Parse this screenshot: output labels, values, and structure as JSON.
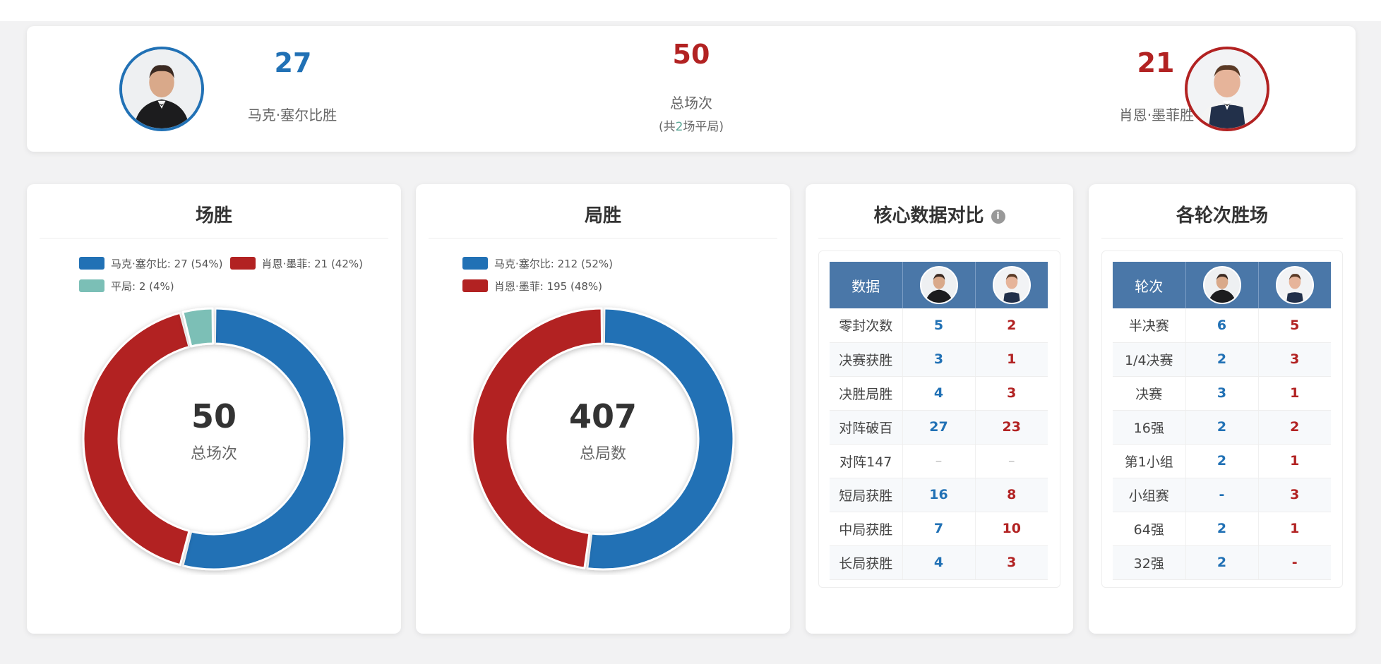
{
  "header": {
    "left": {
      "wins": "27",
      "label": "马克·塞尔比胜",
      "avatar_icon": "player-avatar-selby"
    },
    "center": {
      "total": "50",
      "label": "总场次",
      "note_prefix": "(共",
      "draws": "2",
      "note_suffix": "场平局)"
    },
    "right": {
      "wins": "21",
      "label": "肖恩·墨菲胜",
      "avatar_icon": "player-avatar-murphy"
    }
  },
  "colors": {
    "blue": "#2171b5",
    "red": "#b22222",
    "teal": "#7bbfb6",
    "table_header": "#4a77a8"
  },
  "match_wins": {
    "title": "场胜",
    "legend": [
      "马克·塞尔比: 27 (54%)",
      "肖恩·墨菲: 21 (42%)",
      "平局: 2 (4%)"
    ],
    "center_value": "50",
    "center_label": "总场次"
  },
  "frame_wins": {
    "title": "局胜",
    "legend": [
      "马克·塞尔比: 212 (52%)",
      "肖恩·墨菲: 195 (48%)"
    ],
    "center_value": "407",
    "center_label": "总局数"
  },
  "chart_data": [
    {
      "type": "pie",
      "title": "场胜",
      "categories": [
        "马克·塞尔比",
        "肖恩·墨菲",
        "平局"
      ],
      "values": [
        27,
        21,
        2
      ],
      "percents": [
        54,
        42,
        4
      ],
      "colors": [
        "#2171b5",
        "#b22222",
        "#7bbfb6"
      ],
      "legend": "top"
    },
    {
      "type": "pie",
      "title": "局胜",
      "categories": [
        "马克·塞尔比",
        "肖恩·墨菲"
      ],
      "values": [
        212,
        195
      ],
      "percents": [
        52,
        48
      ],
      "colors": [
        "#2171b5",
        "#b22222"
      ],
      "legend": "top"
    }
  ],
  "core_stats": {
    "title": "核心数据对比",
    "info_icon": "info-icon",
    "header_label": "数据",
    "rows": [
      {
        "name": "零封次数",
        "a": "5",
        "b": "2"
      },
      {
        "name": "决赛获胜",
        "a": "3",
        "b": "1"
      },
      {
        "name": "决胜局胜",
        "a": "4",
        "b": "3"
      },
      {
        "name": "对阵破百",
        "a": "27",
        "b": "23"
      },
      {
        "name": "对阵147",
        "a": "–",
        "b": "–"
      },
      {
        "name": "短局获胜",
        "a": "16",
        "b": "8"
      },
      {
        "name": "中局获胜",
        "a": "7",
        "b": "10"
      },
      {
        "name": "长局获胜",
        "a": "4",
        "b": "3"
      }
    ]
  },
  "round_wins": {
    "title": "各轮次胜场",
    "header_label": "轮次",
    "rows": [
      {
        "name": "半决赛",
        "a": "6",
        "b": "5"
      },
      {
        "name": "1/4决赛",
        "a": "2",
        "b": "3"
      },
      {
        "name": "决赛",
        "a": "3",
        "b": "1"
      },
      {
        "name": "16强",
        "a": "2",
        "b": "2"
      },
      {
        "name": "第1小组",
        "a": "2",
        "b": "1"
      },
      {
        "name": "小组赛",
        "a": "-",
        "b": "3"
      },
      {
        "name": "64强",
        "a": "2",
        "b": "1"
      },
      {
        "name": "32强",
        "a": "2",
        "b": "-"
      }
    ]
  }
}
